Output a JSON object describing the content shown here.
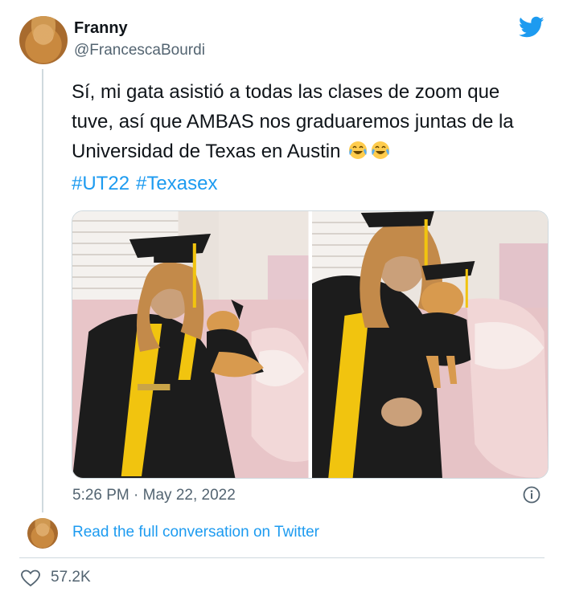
{
  "author": {
    "display_name": "Franny",
    "handle": "@FrancescaBourdi"
  },
  "tweet": {
    "text": "Sí, mi gata asistió a todas las clases de zoom que tuve, así que AMBAS nos graduaremos juntas de la Universidad de Texas en Austin",
    "emoji": [
      "face-with-tears-of-joy",
      "face-with-tears-of-joy"
    ],
    "hashtags": [
      "#UT22",
      "#Texasex"
    ]
  },
  "media": {
    "photos": [
      {
        "description_icon": "graduation-photo-with-cat"
      },
      {
        "description_icon": "graduation-photo-holding-cat"
      }
    ]
  },
  "meta": {
    "timestamp": "5:26 PM · May 22, 2022",
    "read_link": "Read the full conversation on Twitter",
    "likes": "57.2K"
  },
  "colors": {
    "accent": "#1d9bf0",
    "muted": "#536471",
    "border": "#cfd9de"
  }
}
